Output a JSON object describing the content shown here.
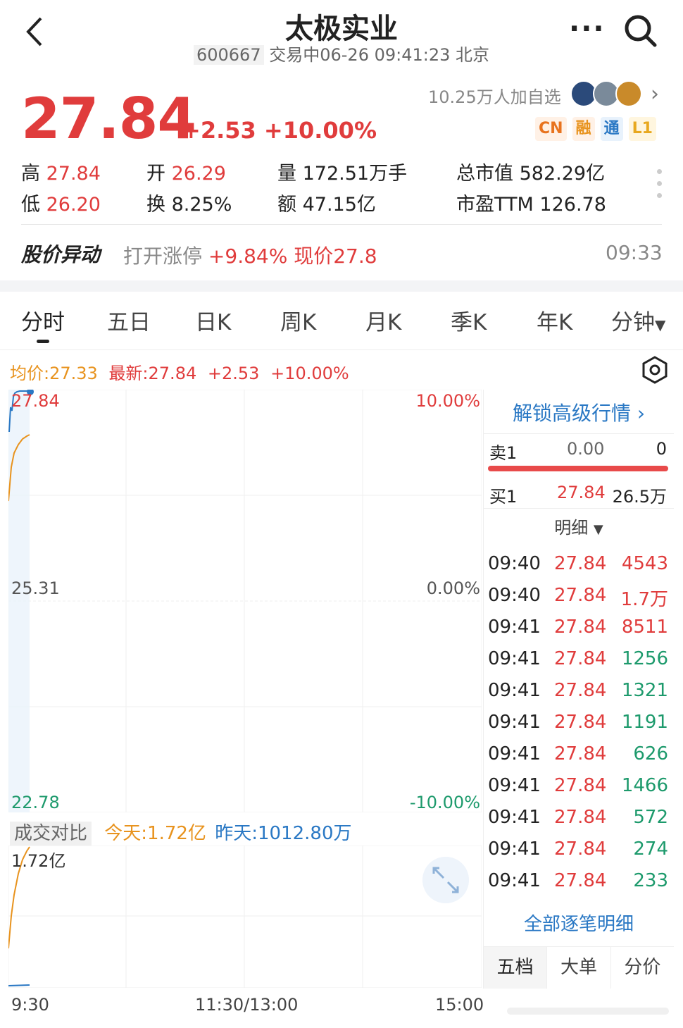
{
  "header": {
    "title": "太极实业",
    "code": "600667",
    "status": "交易中06-26 09:41:23 北京"
  },
  "quote": {
    "price": "27.84",
    "change": "+2.53 +10.00%",
    "watchers": "10.25万人加自选",
    "badges": [
      "CN",
      "融",
      "通",
      "L1"
    ]
  },
  "stats": {
    "high_label": "高",
    "high": "27.84",
    "low_label": "低",
    "low": "26.20",
    "open_label": "开",
    "open": "26.29",
    "turnover_label": "换",
    "turnover": "8.25%",
    "volume_label": "量",
    "volume": "172.51万手",
    "amount_label": "额",
    "amount": "47.15亿",
    "mktcap_label": "总市值",
    "mktcap": "582.29亿",
    "pe_label": "市盈TTM",
    "pe": "126.78"
  },
  "alert": {
    "title": "股价异动",
    "prefix": "打开涨停",
    "text": "+9.84% 现价27.8",
    "time": "09:33"
  },
  "tabs": [
    "分时",
    "五日",
    "日K",
    "周K",
    "月K",
    "季K",
    "年K",
    "分钟"
  ],
  "legend": {
    "avg": "均价:27.33",
    "latest": "最新:27.84",
    "change": "+2.53",
    "pct": "+10.00%"
  },
  "chart_labels": {
    "y_top": "27.84",
    "y_mid": "25.31",
    "y_bot": "22.78",
    "pct_top": "10.00%",
    "pct_mid": "0.00%",
    "pct_bot": "-10.00%",
    "vol_tag": "成交对比",
    "vol_today": "今天:1.72亿",
    "vol_yest": "昨天:1012.80万",
    "vol_max": "1.72亿",
    "x_start": "9:30",
    "x_mid": "11:30/13:00",
    "x_end": "15:00"
  },
  "orderbook": {
    "unlock": "解锁高级行情",
    "sell_label": "卖1",
    "sell_price": "0.00",
    "sell_vol": "0",
    "buy_label": "买1",
    "buy_price": "27.84",
    "buy_vol": "26.5万",
    "detail_label": "明细",
    "all_trades": "全部逐笔明细",
    "bottom_tabs": [
      "五档",
      "大单",
      "分价"
    ]
  },
  "trades": [
    {
      "time": "09:40",
      "price": "27.84",
      "vol": "4543",
      "side": "buy"
    },
    {
      "time": "09:40",
      "price": "27.84",
      "vol": "1.7万",
      "side": "buy"
    },
    {
      "time": "09:41",
      "price": "27.84",
      "vol": "8511",
      "side": "buy"
    },
    {
      "time": "09:41",
      "price": "27.84",
      "vol": "1256",
      "side": "sell"
    },
    {
      "time": "09:41",
      "price": "27.84",
      "vol": "1321",
      "side": "sell"
    },
    {
      "time": "09:41",
      "price": "27.84",
      "vol": "1191",
      "side": "sell"
    },
    {
      "time": "09:41",
      "price": "27.84",
      "vol": "626",
      "side": "sell"
    },
    {
      "time": "09:41",
      "price": "27.84",
      "vol": "1466",
      "side": "sell"
    },
    {
      "time": "09:41",
      "price": "27.84",
      "vol": "572",
      "side": "sell"
    },
    {
      "time": "09:41",
      "price": "27.84",
      "vol": "274",
      "side": "sell"
    },
    {
      "time": "09:41",
      "price": "27.84",
      "vol": "233",
      "side": "sell"
    }
  ],
  "colors": {
    "up": "#e03c3c",
    "down": "#1d9a6c",
    "avg": "#e8931e",
    "link": "#2a78c4"
  }
}
